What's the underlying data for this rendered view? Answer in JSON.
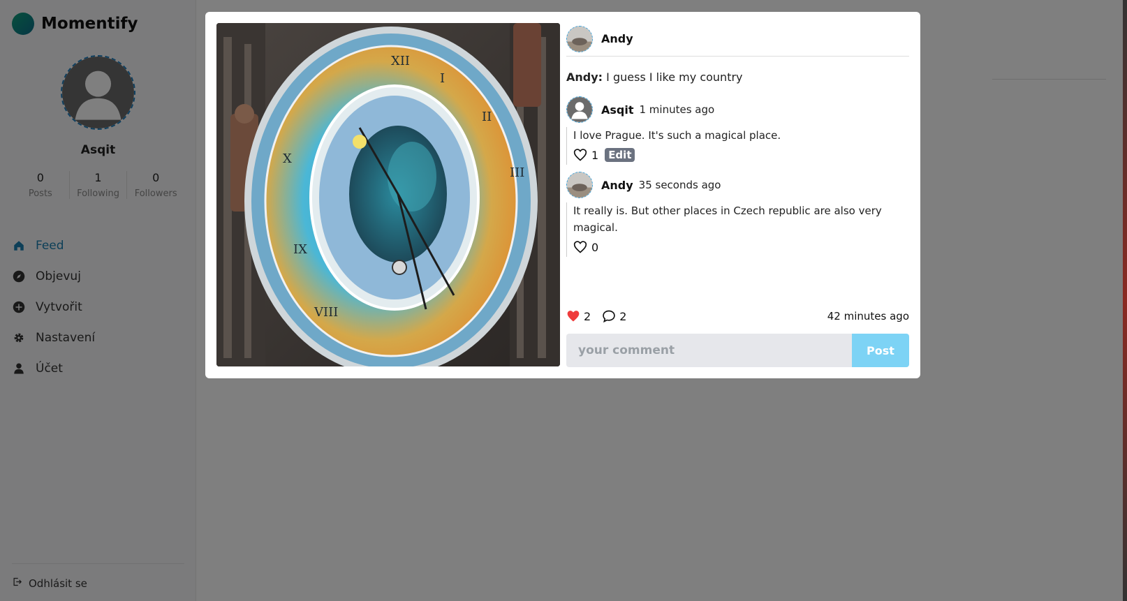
{
  "app": {
    "brand": "Momentify",
    "accent_color": "#1a7fb0"
  },
  "sidebar": {
    "profile_name": "Asqit",
    "stats": [
      {
        "value": "0",
        "label": "Posts"
      },
      {
        "value": "1",
        "label": "Following"
      },
      {
        "value": "0",
        "label": "Followers"
      }
    ],
    "nav": [
      {
        "label": "Feed",
        "icon": "home-icon",
        "active": true
      },
      {
        "label": "Objevuj",
        "icon": "compass-icon",
        "active": false
      },
      {
        "label": "Vytvořit",
        "icon": "plus-circle-icon",
        "active": false
      },
      {
        "label": "Nastavení",
        "icon": "gear-icon",
        "active": false
      },
      {
        "label": "Účet",
        "icon": "user-icon",
        "active": false
      }
    ],
    "logout_label": "Odhlásit se"
  },
  "modal": {
    "author": "Andy",
    "caption_author": "Andy:",
    "caption_text": "I guess I like my country",
    "comments": [
      {
        "author": "Asqit",
        "time": "1 minutes ago",
        "text": "I love Prague. It's such a magical place.",
        "likes": "1",
        "edit_label": "Edit"
      },
      {
        "author": "Andy",
        "time": "35 seconds ago",
        "text": "It really is. But other places in Czech republic are also very magical.",
        "likes": "0"
      }
    ],
    "likes_count": "2",
    "comments_count": "2",
    "posted_time": "42 minutes ago",
    "comment_placeholder": "your comment",
    "post_button": "Post",
    "like_color": "#ef3b3b",
    "post_button_color": "#7dd3f5"
  }
}
